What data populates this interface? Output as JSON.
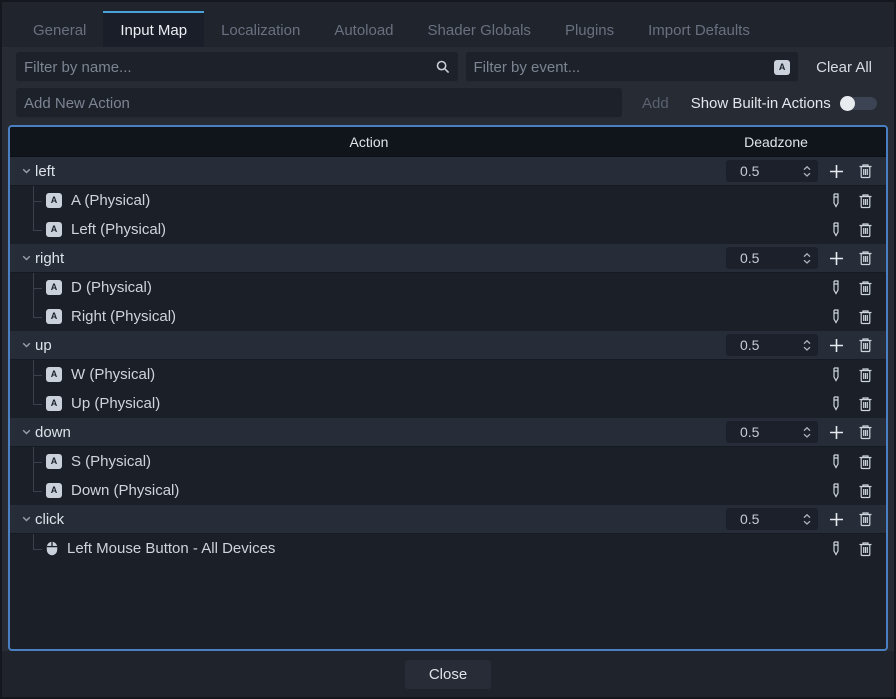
{
  "tabs": {
    "active": "Input Map",
    "items": [
      {
        "label": "General"
      },
      {
        "label": "Input Map"
      },
      {
        "label": "Localization"
      },
      {
        "label": "Autoload"
      },
      {
        "label": "Shader Globals"
      },
      {
        "label": "Plugins"
      },
      {
        "label": "Import Defaults"
      }
    ]
  },
  "filters": {
    "name_placeholder": "Filter by name...",
    "event_placeholder": "Filter by event...",
    "clear_all": "Clear All"
  },
  "add_action": {
    "placeholder": "Add New Action",
    "add": "Add",
    "show_builtin": "Show Built-in Actions",
    "toggle_state": "off"
  },
  "table": {
    "header": {
      "action": "Action",
      "deadzone": "Deadzone"
    },
    "actions": [
      {
        "name": "left",
        "deadzone": "0.5",
        "events": [
          {
            "icon": "keyboard-key",
            "label": "A (Physical)"
          },
          {
            "icon": "keyboard-key",
            "label": "Left (Physical)"
          }
        ]
      },
      {
        "name": "right",
        "deadzone": "0.5",
        "events": [
          {
            "icon": "keyboard-key",
            "label": "D (Physical)"
          },
          {
            "icon": "keyboard-key",
            "label": "Right (Physical)"
          }
        ]
      },
      {
        "name": "up",
        "deadzone": "0.5",
        "events": [
          {
            "icon": "keyboard-key",
            "label": "W (Physical)"
          },
          {
            "icon": "keyboard-key",
            "label": "Up (Physical)"
          }
        ]
      },
      {
        "name": "down",
        "deadzone": "0.5",
        "events": [
          {
            "icon": "keyboard-key",
            "label": "S (Physical)"
          },
          {
            "icon": "keyboard-key",
            "label": "Down (Physical)"
          }
        ]
      },
      {
        "name": "click",
        "deadzone": "0.5",
        "events": [
          {
            "icon": "mouse",
            "label": "Left Mouse Button - All Devices"
          }
        ]
      }
    ]
  },
  "footer": {
    "close": "Close"
  },
  "colors": {
    "accent_blue": "#4aa0d8",
    "panel_border": "#4a80c1"
  }
}
